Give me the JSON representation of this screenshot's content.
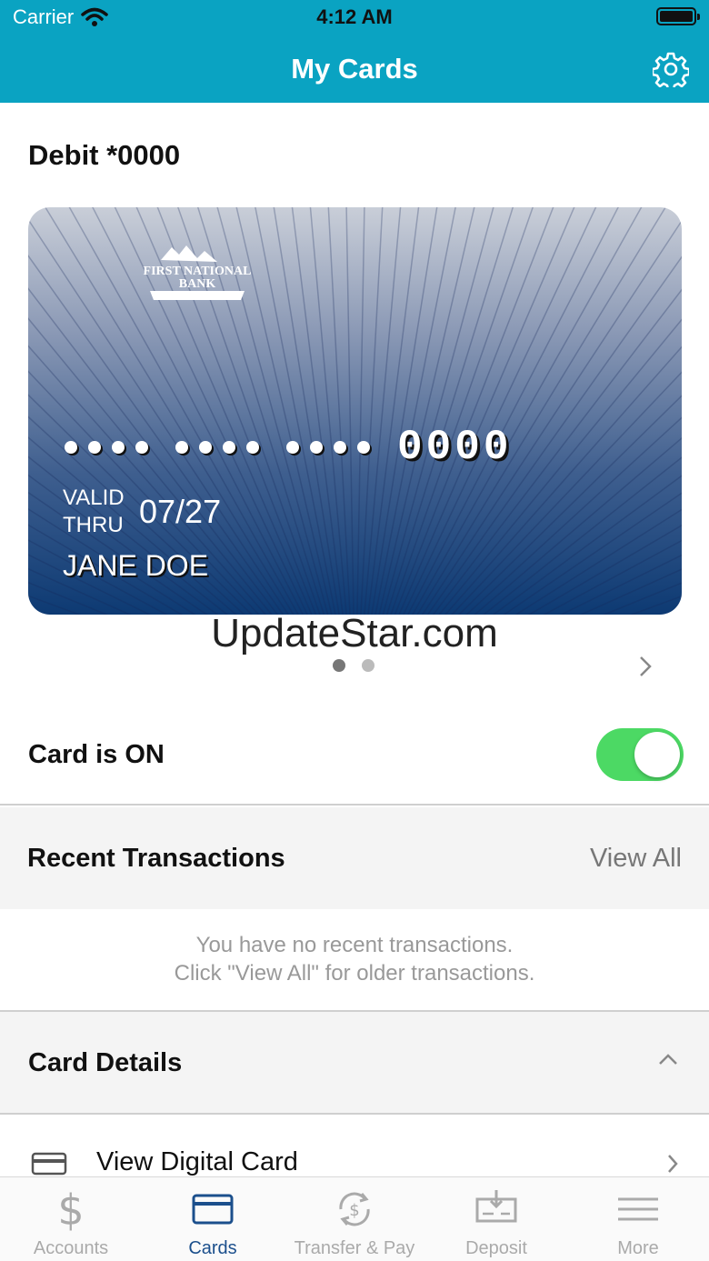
{
  "status_bar": {
    "carrier": "Carrier",
    "time": "4:12 AM"
  },
  "header": {
    "title": "My Cards"
  },
  "card_section": {
    "heading": "Debit *0000",
    "card": {
      "bank_name": "FIRST NATIONAL BANK",
      "last4": "0000",
      "valid_label_1": "VALID",
      "valid_label_2": "THRU",
      "expiry": "07/27",
      "holder": "JANE DOE"
    },
    "watermark": "UpdateStar.com",
    "pager": {
      "total": 2,
      "active": 1
    }
  },
  "card_toggle": {
    "label": "Card is ON",
    "on": true
  },
  "recent_transactions": {
    "title": "Recent Transactions",
    "view_all": "View All",
    "empty_line_1": "You have no recent transactions.",
    "empty_line_2": "Click \"View All\" for older transactions."
  },
  "card_details": {
    "title": "Card Details",
    "items": [
      {
        "label": "View Digital Card",
        "icon": "card-icon"
      }
    ]
  },
  "tabbar": {
    "tabs": [
      {
        "label": "Accounts",
        "icon": "dollar-icon"
      },
      {
        "label": "Cards",
        "icon": "card-icon"
      },
      {
        "label": "Transfer & Pay",
        "icon": "transfer-icon"
      },
      {
        "label": "Deposit",
        "icon": "check-deposit-icon"
      },
      {
        "label": "More",
        "icon": "menu-icon"
      }
    ],
    "active": "Cards"
  },
  "colors": {
    "header": "#0aa3c2",
    "toggle_on": "#4cd964",
    "active_tab": "#1b4f8c",
    "inactive_tab": "#aaaaaa"
  }
}
